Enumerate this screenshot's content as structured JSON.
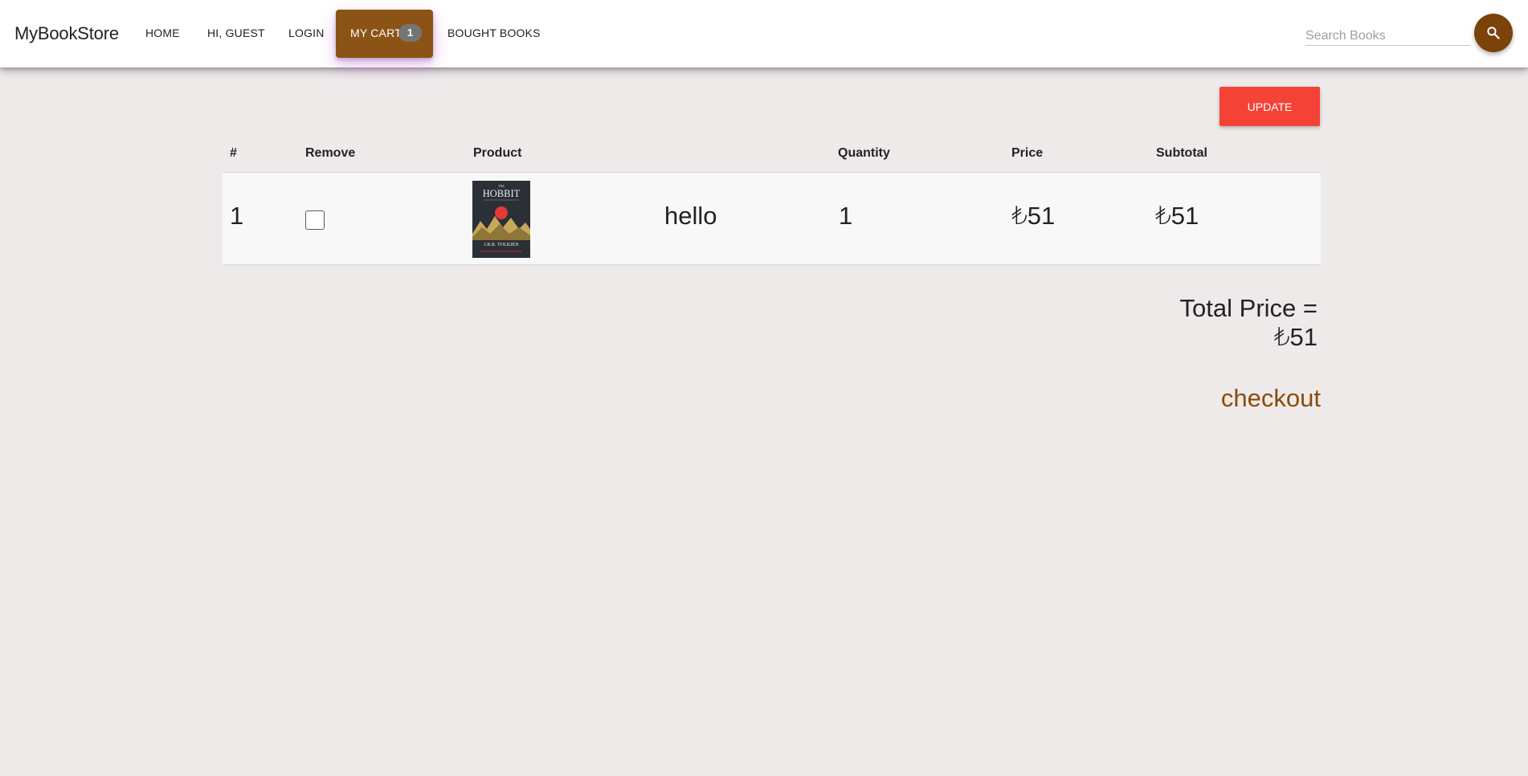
{
  "navbar": {
    "brand": "MyBookStore",
    "items": [
      {
        "label": "HOME"
      },
      {
        "label": "HI, GUEST"
      },
      {
        "label": "LOGIN"
      },
      {
        "label": "MY CART",
        "badge": "1",
        "active": true
      },
      {
        "label": "BOUGHT BOOKS"
      }
    ],
    "search": {
      "placeholder": "Search Books",
      "value": "",
      "icon": "search-icon"
    }
  },
  "colors": {
    "accent": "#8b5316",
    "search_button": "#7b420a",
    "update_button": "#f44336",
    "checkout_link": "#8b4a0c",
    "page_background": "#eeeaea"
  },
  "cart": {
    "update_label": "UPDATE",
    "columns": [
      "#",
      "Remove",
      "Product",
      "Quantity",
      "Price",
      "Subtotal"
    ],
    "rows": [
      {
        "index": "1",
        "remove_checked": false,
        "cover_text": "HOBBIT",
        "cover_author": "J.R.R. TOLKIEN",
        "title": "hello",
        "quantity": "1",
        "price": "₺51",
        "subtotal": "₺51"
      }
    ],
    "total": "Total Price = ₺51",
    "checkout_label": "checkout"
  }
}
